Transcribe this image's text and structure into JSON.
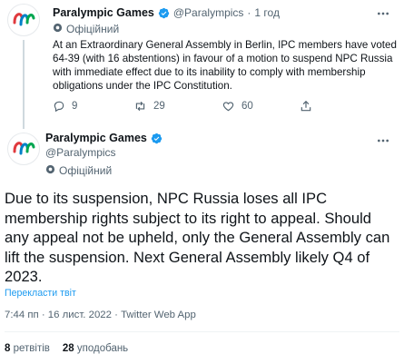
{
  "tweet1": {
    "name": "Paralympic Games",
    "handle": "@Paralympics",
    "time": "1 год",
    "official_label": "Офіційний",
    "text": "At an Extraordinary General Assembly in Berlin, IPC members have voted 64-39 (with 16 abstentions) in favour of a motion to suspend NPC Russia with immediate effect due to its inability to comply with membership obligations under the IPC Constitution.",
    "actions": {
      "replies": "9",
      "retweets": "29",
      "likes": "60"
    }
  },
  "tweet2": {
    "name": "Paralympic Games",
    "handle": "@Paralympics",
    "official_label": "Офіційний",
    "text": "Due to its suspension, NPC Russia loses all IPC membership rights subject to its right to appeal. Should any appeal not be upheld, only the General Assembly can lift the suspension. Next General Assembly likely Q4 of 2023.",
    "translate_label": "Перекласти твіт",
    "meta": "7:44 пп · 16 лист. 2022 · Twitter Web App",
    "stats": {
      "retweets_count": "8",
      "retweets_label": "ретвітів",
      "likes_count": "28",
      "likes_label": "уподобань"
    }
  },
  "colors": {
    "accent": "#1d9bf0",
    "verified": "#1d9bf0",
    "muted": "#536471"
  }
}
